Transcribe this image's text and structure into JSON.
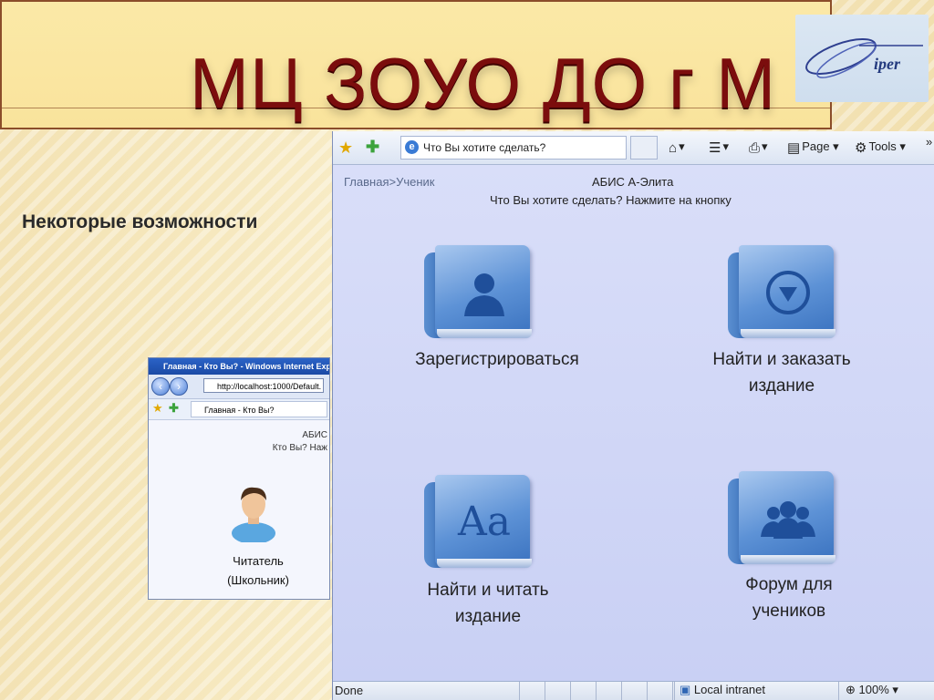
{
  "slide": {
    "title": "МЦ ЗОУО ДО г М",
    "subtitle": "Некоторые возможности",
    "logo_text": "iper"
  },
  "mini_window": {
    "title": "Главная - Кто Вы? - Windows Internet Explo",
    "url": "http://localhost:1000/Default.",
    "tab": "Главная - Кто Вы?",
    "abis": "АБИС",
    "question": "Кто Вы? Наж",
    "caption_line1": "Читатель",
    "caption_line2": "(Школьник)"
  },
  "browser": {
    "tab_title": "Что Вы хотите сделать?",
    "menu": {
      "page": "Page",
      "tools": "Tools",
      "more": "»"
    },
    "breadcrumb": {
      "home": "Главная",
      "separator": ">",
      "current": "Ученик"
    },
    "app_title": "АБИС А-Элита",
    "prompt": "Что Вы хотите сделать? Нажмите на кнопку",
    "tiles": [
      {
        "label": "Зарегистрироваться",
        "icon": "person-icon"
      },
      {
        "label_line1": "Найти и заказать",
        "label_line2": "издание",
        "icon": "download-arrow-icon"
      },
      {
        "label_line1": "Найти и читать",
        "label_line2": "издание",
        "icon": "font-aa-icon"
      },
      {
        "label_line1": "Форум для",
        "label_line2": "учеников",
        "icon": "group-icon"
      }
    ],
    "status": {
      "left": "Done",
      "zone": "Local intranet",
      "zoom": "100%"
    }
  },
  "colors": {
    "title_red": "#7b0d0d",
    "banner": "#fbe9a7",
    "content_bg": "#d0d6f6",
    "tile_blue": "#5d92d6"
  }
}
